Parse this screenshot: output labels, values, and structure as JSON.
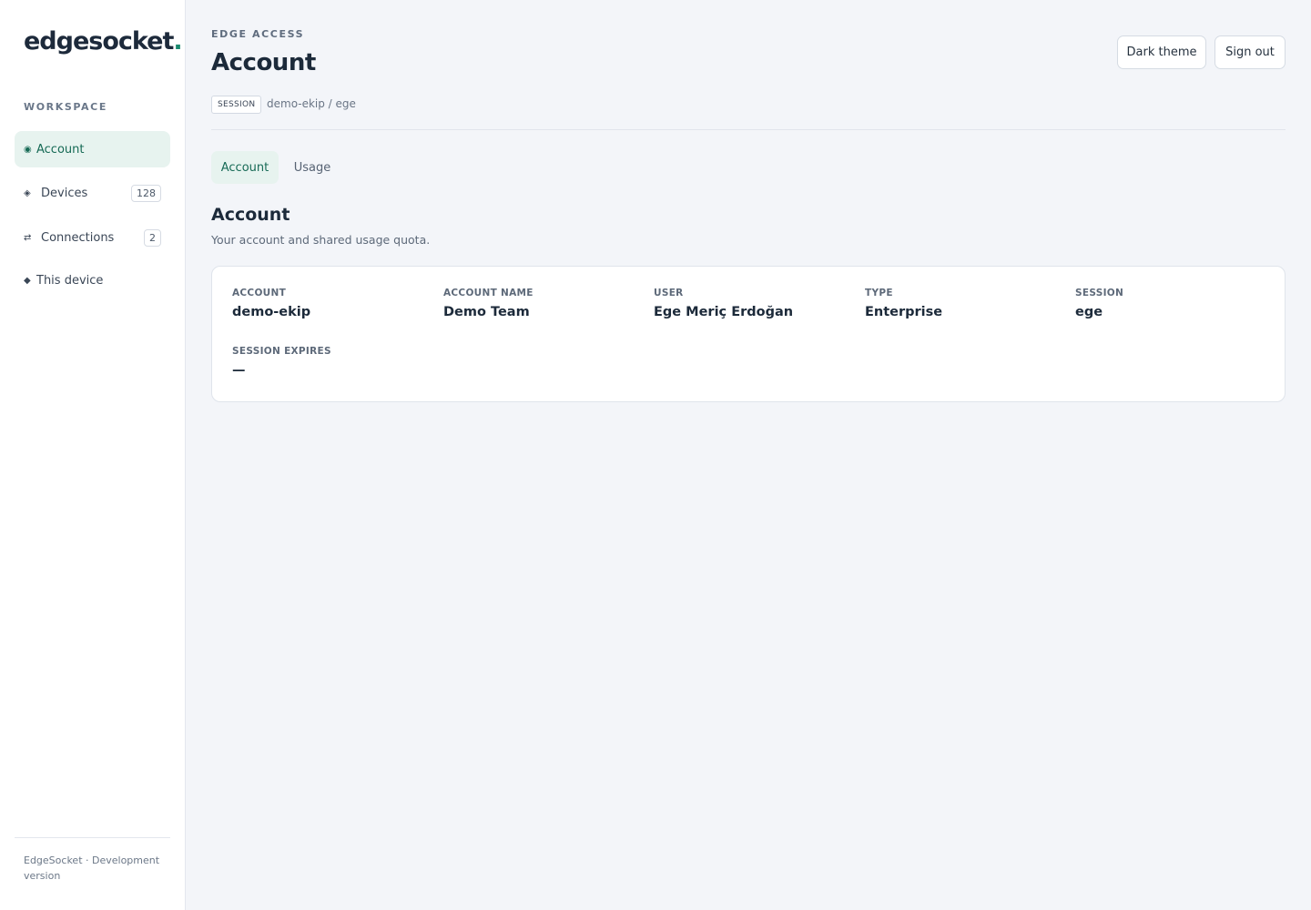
{
  "sidebar": {
    "logo_text": "edgesocket",
    "logo_dot": ".",
    "section_label": "WORKSPACE",
    "items": [
      {
        "label": "Account",
        "icon": "◉",
        "icon_name": "account-icon"
      },
      {
        "label": "Devices",
        "icon": "◈",
        "icon_name": "devices-icon",
        "badge": "128"
      },
      {
        "label": "Connections",
        "icon": "⇄",
        "icon_name": "connections-icon",
        "badge": "2"
      },
      {
        "label": "This device",
        "icon": "◆",
        "icon_name": "this-device-icon"
      }
    ],
    "footer": "EdgeSocket · Development version"
  },
  "header": {
    "eyebrow": "EDGE ACCESS",
    "title": "Account",
    "session_tag": "SESSION",
    "session_path": "demo-ekip / ege",
    "theme_button": "Dark theme",
    "signout_button": "Sign out"
  },
  "tabs": [
    {
      "label": "Account",
      "active": true
    },
    {
      "label": "Usage",
      "active": false
    }
  ],
  "section": {
    "title": "Account",
    "subtitle": "Your account and shared usage quota."
  },
  "details": [
    {
      "label": "ACCOUNT",
      "value": "demo-ekip"
    },
    {
      "label": "ACCOUNT NAME",
      "value": "Demo Team"
    },
    {
      "label": "USER",
      "value": "Ege Meriç Erdoğan"
    },
    {
      "label": "TYPE",
      "value": "Enterprise"
    },
    {
      "label": "SESSION",
      "value": "ege"
    },
    {
      "label": "SESSION EXPIRES",
      "value": "—"
    }
  ],
  "colors": {
    "accent": "#1a8a6e",
    "active_bg": "#e7f3ef",
    "page_bg": "#f3f5f9"
  }
}
